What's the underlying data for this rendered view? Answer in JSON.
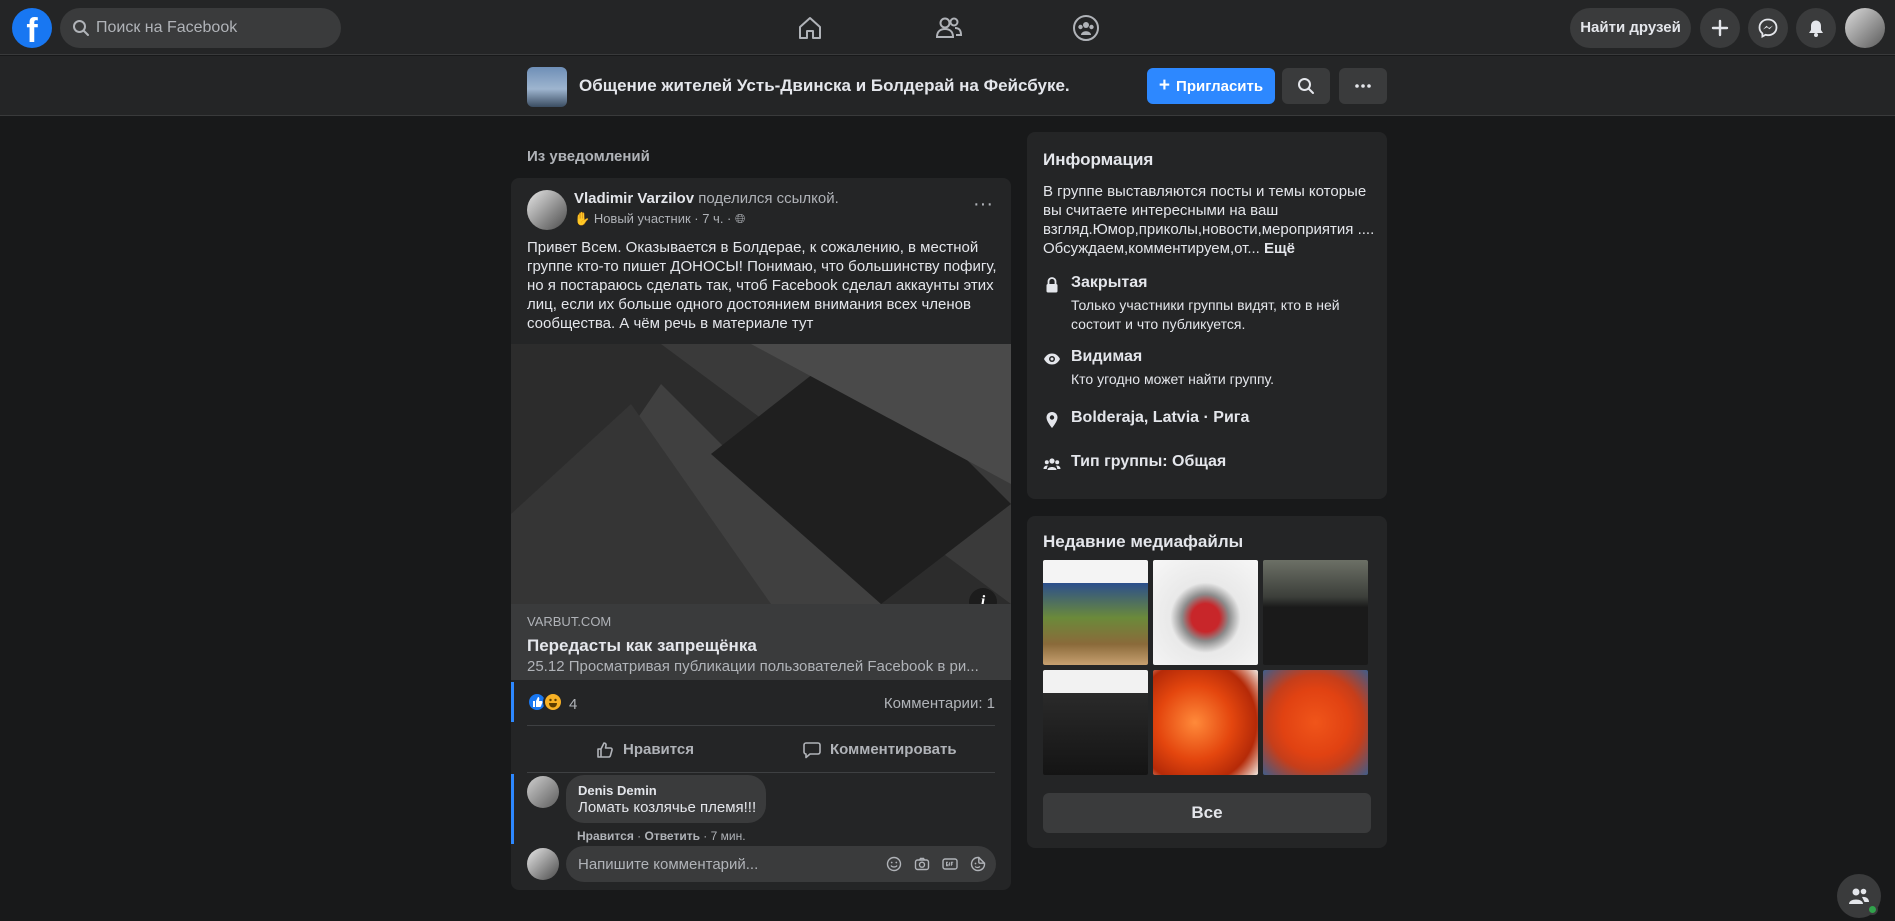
{
  "topnav": {
    "logo": "f",
    "search_placeholder": "Поиск на Facebook",
    "find_friends": "Найти друзей",
    "icons": [
      "home-icon",
      "friends-icon",
      "groups-icon",
      "plus-icon",
      "messenger-icon",
      "bell-icon"
    ]
  },
  "group": {
    "title": "Общение жителей Усть-Двинска и Болдерай на Фейсбуке.",
    "invite": "Пригласить",
    "more": "···"
  },
  "feed": {
    "section_label": "Из уведомлений",
    "post": {
      "author": "Vladimir Varzilov",
      "action": "поделился ссылкой.",
      "badge": "Новый участник",
      "time": "· 7 ч. ·",
      "more": "···",
      "text": "Привет Всем. Оказывается в Болдерае, к сожалению, в местной группе кто-то пишет ДОНОСЫ! Понимаю, что большинству пофигу, но я постараюсь сделать так, чтоб Facebook  сделал аккаунты этих лиц, если их больше одного достоянием внимания всех членов сообщества. А чём речь в материале тут",
      "link": {
        "info_glyph": "i",
        "domain": "VARBUT.COM",
        "title": "Передасты как запрещёнка",
        "description": "25.12 Просматривая публикации пользователей Facebook в ри..."
      },
      "reactions_count": "4",
      "comments_count": "Комментарии: 1",
      "like_label": "Нравится",
      "comment_label": "Комментировать",
      "comment": {
        "author": "Denis Demin",
        "text": "Ломать козлячье племя!!!",
        "like": "Нравится",
        "reply": "Ответить",
        "time": "7 мин."
      },
      "write_placeholder": "Напишите комментарий..."
    }
  },
  "about": {
    "title": "Информация",
    "description": "В группе выставляются посты и темы которые вы считаете интересными на ваш взгляд.Юмор,приколы,новости,мероприятия .... Обсуждаем,комментируем,от...",
    "more": "Ещё",
    "items": [
      {
        "icon": "lock-icon",
        "title": "Закрытая",
        "subtitle": "Только участники группы видят, кто в ней состоит и что публикуется."
      },
      {
        "icon": "eye-icon",
        "title": "Видимая",
        "subtitle": "Кто угодно может найти группу."
      },
      {
        "icon": "location-pin-icon",
        "title": "Bolderaja, Latvia · Рига",
        "subtitle": ""
      },
      {
        "icon": "people-icon",
        "title": "Тип группы: Общая",
        "subtitle": ""
      }
    ]
  },
  "media": {
    "title": "Недавние медиафайлы",
    "all_button": "Все"
  },
  "colors": {
    "accent": "#2d88ff",
    "background": "#18191a",
    "surface": "#242526",
    "secondary_surface": "#3a3b3c"
  }
}
